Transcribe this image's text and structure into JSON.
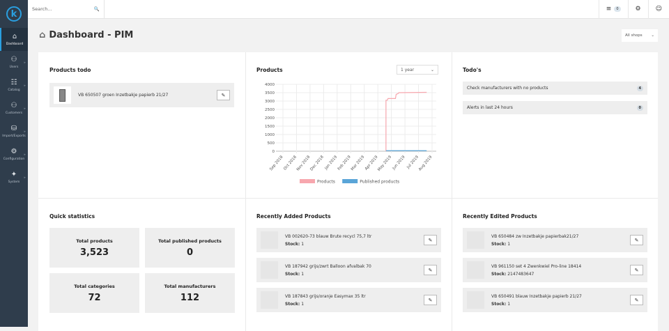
{
  "sidebar": {
    "items": [
      {
        "label": "Dashboard",
        "icon": "home-icon"
      },
      {
        "label": "Users",
        "icon": "users-icon"
      },
      {
        "label": "Catalog",
        "icon": "sitemap-icon"
      },
      {
        "label": "Customers",
        "icon": "users-icon"
      },
      {
        "label": "Import/Exports",
        "icon": "database-icon"
      },
      {
        "label": "Configuration",
        "icon": "gear-icon"
      },
      {
        "label": "System",
        "icon": "magic-icon"
      }
    ]
  },
  "topbar": {
    "search_placeholder": "Search...",
    "tasks_count": "0"
  },
  "page": {
    "title": "Dashboard - PIM",
    "shop_select": "All shops"
  },
  "products_todo": {
    "title": "Products todo",
    "items": [
      {
        "name": "VB 650507 groen Inzetbakje papierb 21/27"
      }
    ]
  },
  "products_chart": {
    "title": "Products",
    "range": "1 year"
  },
  "todos": {
    "title": "Todo's",
    "items": [
      {
        "label": "Check manufacturers with no products",
        "count": "4"
      },
      {
        "label": "Alerts in last 24 hours",
        "count": "0"
      }
    ]
  },
  "quick_stats": {
    "title": "Quick statistics",
    "items": [
      {
        "label": "Total products",
        "value": "3,523"
      },
      {
        "label": "Total published products",
        "value": "0"
      },
      {
        "label": "Total categories",
        "value": "72"
      },
      {
        "label": "Total manufacturers",
        "value": "112"
      }
    ]
  },
  "recently_added": {
    "title": "Recently Added Products",
    "stock_label": "Stock:",
    "items": [
      {
        "name": "VB 002620-73 blauw Brute recycl 75,7 ltr",
        "stock": "1"
      },
      {
        "name": "VB 187942 grijs/zwrt Balloon afvalbak 70",
        "stock": "1"
      },
      {
        "name": "VB 187843 grijs/oranje Easymax 35 ltr",
        "stock": "1"
      }
    ]
  },
  "recently_edited": {
    "title": "Recently Edited Products",
    "stock_label": "Stock:",
    "items": [
      {
        "name": "VB 650484 zw Inzetbakje papierbak21/27",
        "stock": "1"
      },
      {
        "name": "VB 961150 set 4 Zwenkwiel Pro-line 18414",
        "stock": "2147483647"
      },
      {
        "name": "VB 650491 blauw Inzetbakje papierb 21/27",
        "stock": "1"
      }
    ]
  },
  "chart_data": {
    "type": "line",
    "title": "Products",
    "categories": [
      "Sep 2018",
      "Oct 2018",
      "Nov 2018",
      "Dec 2018",
      "Jan 2019",
      "Feb 2019",
      "Mar 2019",
      "Apr 2019",
      "May 2019",
      "Jun 2019",
      "Jul 2019",
      "Aug 2019"
    ],
    "ylim": [
      0,
      4000
    ],
    "yticks": [
      "0",
      "500",
      "1000",
      "1500",
      "2000",
      "2500",
      "3000",
      "3500",
      "4000"
    ],
    "legend": "bottom",
    "series": [
      {
        "name": "Products",
        "color": "#f7a7ae",
        "points": [
          [
            7.6,
            0
          ],
          [
            7.6,
            3050
          ],
          [
            7.7,
            3050
          ],
          [
            7.75,
            3150
          ],
          [
            8.3,
            3150
          ],
          [
            8.35,
            3400
          ],
          [
            8.5,
            3450
          ],
          [
            8.55,
            3500
          ],
          [
            10.6,
            3520
          ]
        ]
      },
      {
        "name": "Published products",
        "color": "#5aa5d8",
        "points": [
          [
            7.6,
            30
          ],
          [
            10.6,
            30
          ]
        ]
      }
    ]
  }
}
